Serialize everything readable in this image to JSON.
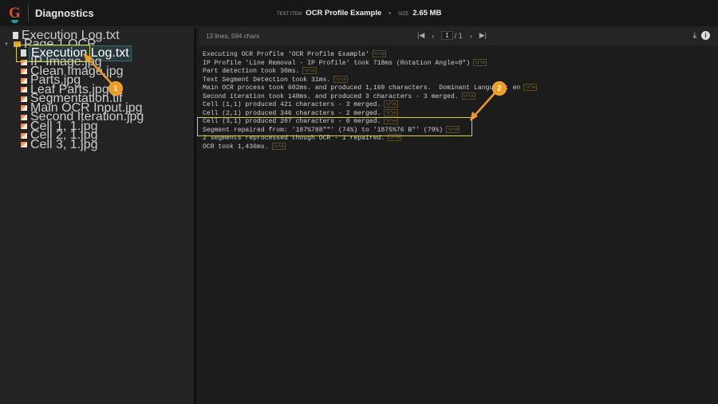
{
  "header": {
    "app_title": "Diagnostics",
    "test_item_label": "TEST ITEM",
    "test_item": "OCR Profile Example",
    "size_label": "SIZE",
    "size": "2.65 MB",
    "logo_letter": "G"
  },
  "tree": {
    "root_file": "Execution Log.txt",
    "folder": "Page 1 OCR",
    "children": [
      "Execution Log.txt",
      "IP Image.jpg",
      "Clean Image.jpg",
      "Parts.jpg",
      "Leaf Parts.jpg",
      "Segmentation.tif",
      "Main OCR Input.jpg",
      "Second Iteration.jpg",
      "Cell 1, 1.jpg",
      "Cell 2, 1.jpg",
      "Cell 3, 1.jpg"
    ],
    "selected": "Execution Log.txt"
  },
  "toolbar": {
    "stats": "13 lines, 594 chars",
    "page": "1",
    "page_total": "/ 1"
  },
  "log": {
    "eol_marker": "\\r\\n",
    "lines": [
      "Executing OCR Profile 'OCR Profile Example'",
      "IP Profile 'Line Removal - IP Profile' took 718ms (Rotation Angle=0\")",
      "Part detection took 30ms.",
      "Text Segment Detection took 31ms.",
      "Main OCR process took 602ms. and produced 1,169 characters.  Dominant Language: en",
      "Second iteration took 140ms. and produced 3 characters - 3 merged.",
      "Cell (1,1) produced 421 characters - 3 merged.",
      "Cell (2,1) produced 346 characters - 2 merged.",
      "Cell (3,1) produced 207 characters - 0 merged.",
      "Segment repaired from: '187%788\"\"' (74%) to '1875%76 B\"' (79%)",
      "2 segments reprocessed though OCR - 1 repaired.",
      "OCR took 1,436ms."
    ]
  },
  "callouts": [
    "1",
    "2"
  ],
  "colors": {
    "accent": "#f29a1e",
    "highlight": "#d8d030"
  }
}
